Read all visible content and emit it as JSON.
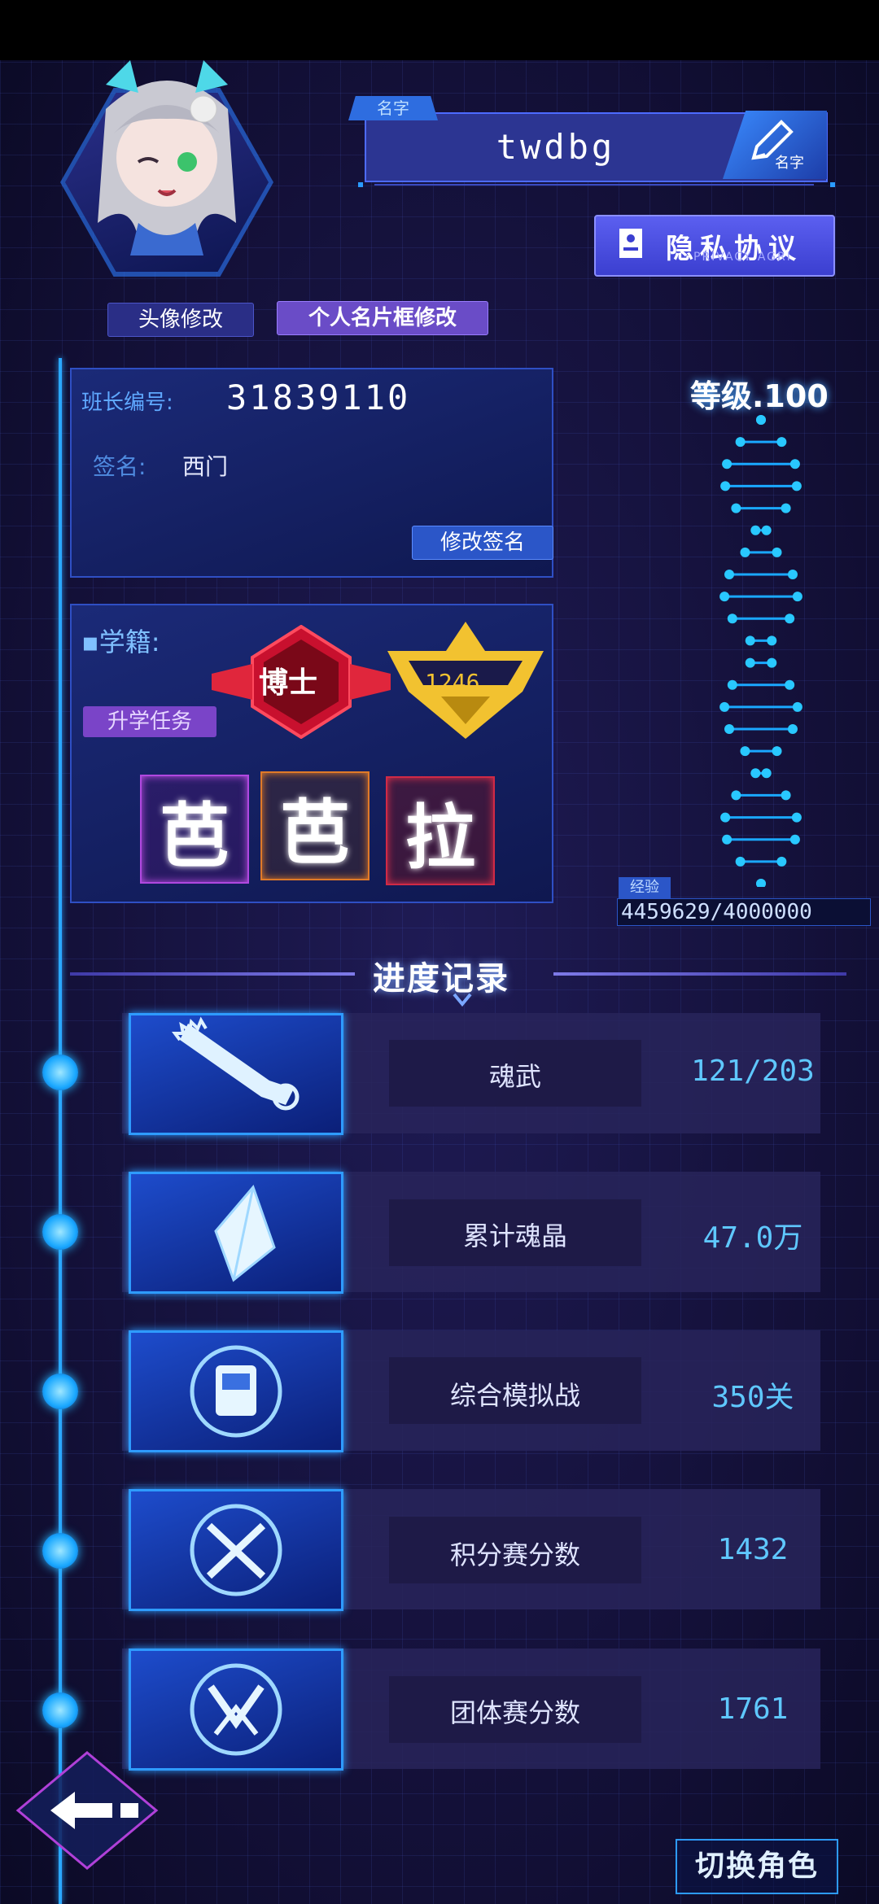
{
  "profile": {
    "name_tag": "名字",
    "name": "twdbg",
    "edit_name_label": "名字",
    "avatar_button": "头像修改",
    "frame_button": "个人名片框修改",
    "privacy_button": "隐私协议",
    "privacy_sub": "PRIVACY AGRI"
  },
  "id_card": {
    "id_label": "班长编号:",
    "id_value": "31839110",
    "sig_label": "签名:",
    "sig_value": "西门",
    "edit_sig_button": "修改签名"
  },
  "school": {
    "label": "▪学籍:",
    "task_button": "升学任务",
    "rank_title": "博士",
    "rank_number": "1246",
    "characters": [
      "芭",
      "芭",
      "拉"
    ]
  },
  "level": {
    "label": "等级.100",
    "exp_label": "经验",
    "exp_value": "4459629/4000000"
  },
  "progress": {
    "title": "进度记录",
    "rows": [
      {
        "label": "魂武",
        "value": "121/203",
        "icon": "chainsaw-icon"
      },
      {
        "label": "累计魂晶",
        "value": "47.0万",
        "icon": "crystal-icon"
      },
      {
        "label": "综合模拟战",
        "value": "350关",
        "icon": "scroll-icon"
      },
      {
        "label": "积分赛分数",
        "value": "1432",
        "icon": "crossed-rifles-icon"
      },
      {
        "label": "团体赛分数",
        "value": "1761",
        "icon": "crossed-swords-icon"
      }
    ]
  },
  "footer": {
    "switch_button": "切换角色"
  },
  "colors": {
    "accent_blue": "#2aa8ff",
    "rank_red": "#e0263c",
    "rank_gold": "#f2c230",
    "value_cyan": "#5fc8ff"
  }
}
